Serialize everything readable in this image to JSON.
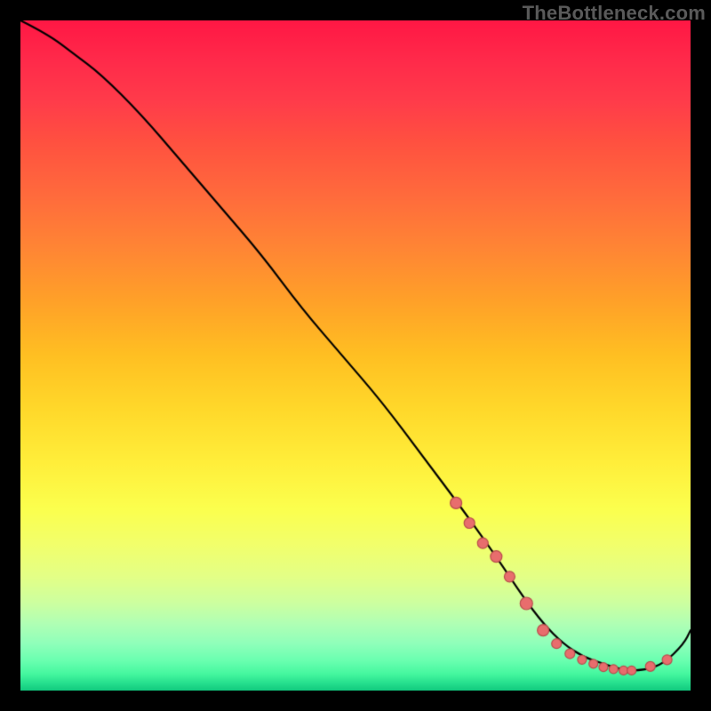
{
  "watermark": "TheBottleneck.com",
  "colors": {
    "background": "#000000",
    "curve": "#000000",
    "marker_fill": "#e86d6d",
    "marker_stroke": "#b84c4c"
  },
  "chart_data": {
    "type": "line",
    "title": "",
    "xlabel": "",
    "ylabel": "",
    "xlim": [
      0,
      100
    ],
    "ylim": [
      0,
      100
    ],
    "grid": false,
    "series": [
      {
        "name": "bottleneck_curve",
        "x": [
          0,
          4,
          8,
          12,
          18,
          24,
          30,
          36,
          42,
          48,
          54,
          60,
          66,
          71,
          75,
          78,
          81,
          84,
          87,
          90,
          93,
          96,
          99,
          100
        ],
        "values": [
          100,
          98,
          95,
          92,
          86,
          79,
          72,
          65,
          57,
          50,
          43,
          35,
          27,
          20,
          14,
          10,
          7,
          5,
          4,
          3,
          3,
          4,
          7,
          9
        ]
      }
    ],
    "markers": {
      "name": "highlighted_points",
      "x": [
        65,
        67,
        69,
        71,
        73,
        75.5,
        78,
        80,
        82,
        83.8,
        85.5,
        87,
        88.5,
        90,
        91.2,
        94,
        96.5
      ],
      "values": [
        28,
        25,
        22,
        20,
        17,
        13,
        9,
        7,
        5.5,
        4.6,
        4,
        3.5,
        3.2,
        3,
        3,
        3.6,
        4.6
      ]
    }
  }
}
